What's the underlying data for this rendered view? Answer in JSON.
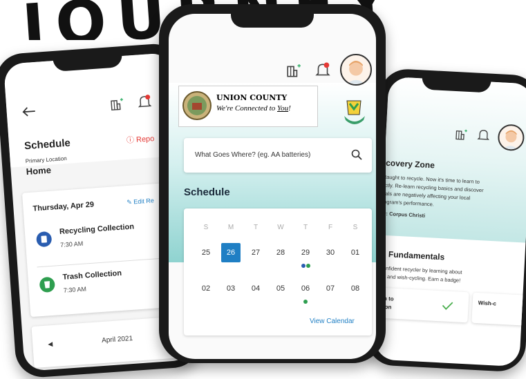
{
  "banner": {
    "text": "JOURNEY"
  },
  "left_phone": {
    "title": "Schedule",
    "report_label": "Repo",
    "primary_location_label": "Primary Location",
    "location_value": "Home",
    "date": "Thursday, Apr 29",
    "edit_label": "Edit Re",
    "events": [
      {
        "title": "Recycling Collection",
        "time": "7:30 AM",
        "color": "#2a5db0"
      },
      {
        "title": "Trash Collection",
        "time": "7:30 AM",
        "color": "#2e9e4f"
      }
    ],
    "month_label": "April 2021"
  },
  "center_phone": {
    "county_name": "UNION COUNTY",
    "county_tagline_prefix": "We're Connected to ",
    "county_tagline_emph": "You",
    "county_tagline_suffix": "!",
    "search_placeholder": "What Goes Where? (eg. AA batteries)",
    "schedule_title": "Schedule",
    "weekdays": [
      "S",
      "M",
      "T",
      "W",
      "T",
      "F",
      "S"
    ],
    "week1": [
      "25",
      "26",
      "27",
      "28",
      "29",
      "30",
      "01"
    ],
    "week2": [
      "02",
      "03",
      "04",
      "05",
      "06",
      "07",
      "08"
    ],
    "selected_day": "26",
    "view_calendar_label": "View Calendar",
    "accent": "#1f7fc4"
  },
  "right_phone": {
    "zone_title": "covery Zone",
    "zone_body_lines": [
      "taught to recycle. Now it's time to learn to",
      "ctly. Re-learn recycling basics and discover",
      "ials are negatively affecting your local",
      "ogram's performance."
    ],
    "zone_author": "y: Corpus Christi",
    "fundamentals_title": "g Fundamentals",
    "fundamentals_body_lines": [
      "confident recycler by learning about",
      "on and wish-cycling. Earn a badge!"
    ],
    "tile1_lines": [
      "ion to",
      "ation"
    ],
    "tile2_label": "Wish-c"
  }
}
